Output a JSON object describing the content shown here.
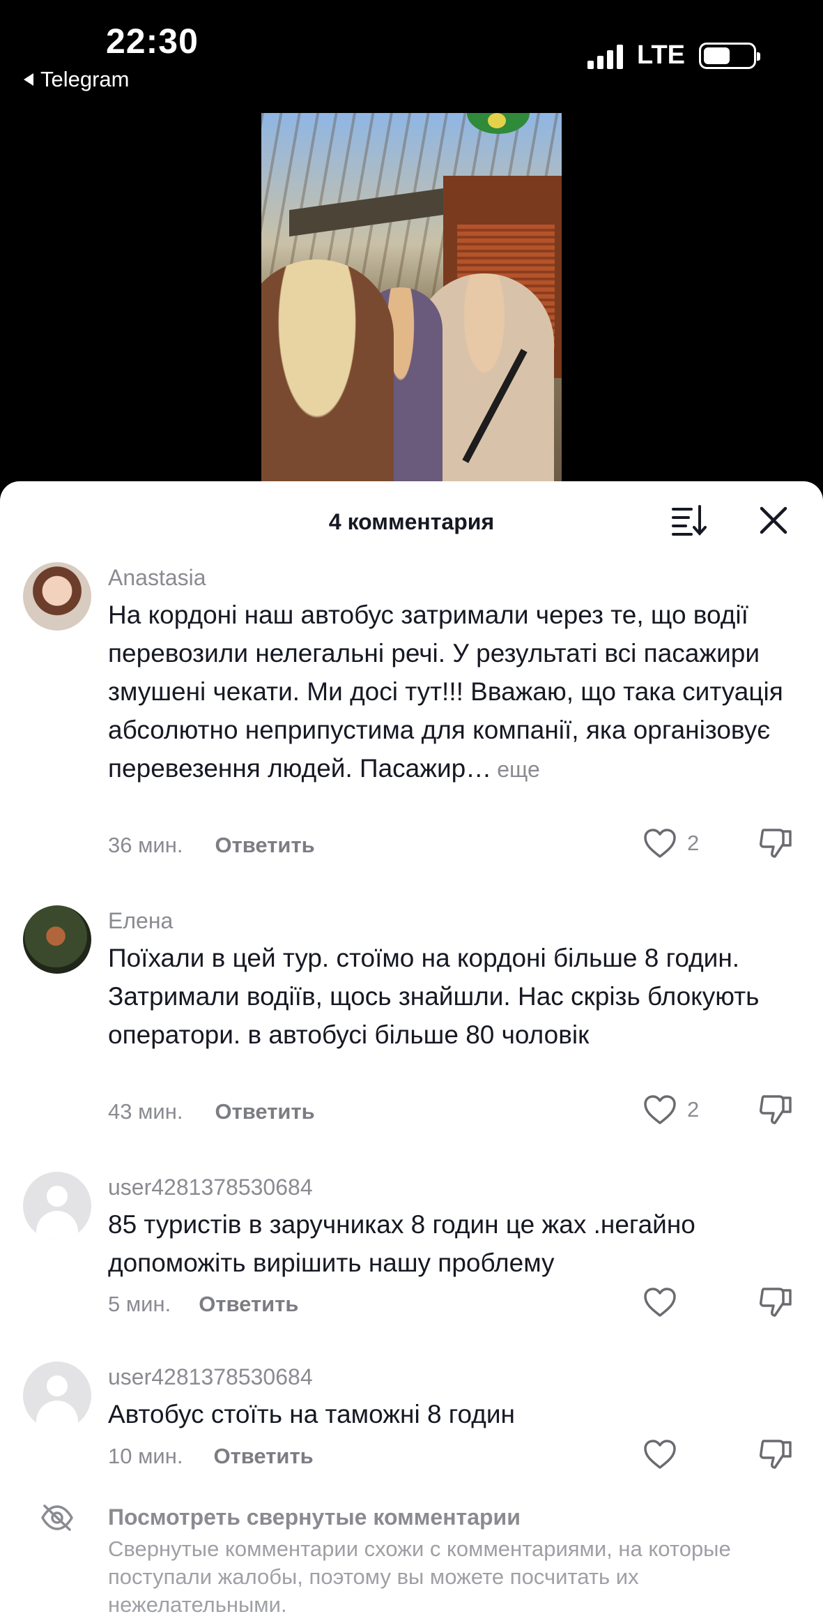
{
  "status_bar": {
    "time": "22:30",
    "back_app": "Telegram",
    "network": "LTE",
    "battery_level": 0.55
  },
  "header": {
    "title": "4 комментария",
    "sort_icon": "sort-icon",
    "close_icon": "close-icon"
  },
  "comments": [
    {
      "username": "Anastasia",
      "text": "На кордоні наш автобус затримали через те, що водії перевозили нелегальні речі. У результаті всі пасажири змушені чекати. Ми досі тут!!! Вважаю, що така ситуація абсолютно неприпустима для компанії, яка організовує перевезення людей. Пасажир…",
      "more": "еще",
      "time": "36 мин.",
      "reply": "Ответить",
      "likes": "2"
    },
    {
      "username": "Елена",
      "text": "Поїхали в цей тур. стоїмо на кордоні більше 8 годин. Затримали водіїв, щось знайшли. Нас скрізь блокують оператори. в автобусі більше 80 чоловік",
      "time": "43 мин.",
      "reply": "Ответить",
      "likes": "2"
    },
    {
      "username": "user4281378530684",
      "text": "85 туристів в заручниках 8 годин це жах .негайно допоможіть вирішить нашу проблему",
      "time": "5 мин.",
      "reply": "Ответить",
      "likes": ""
    },
    {
      "username": "user4281378530684",
      "text": "Автобус стоїть на таможні 8 годин",
      "time": "10 мин.",
      "reply": "Ответить",
      "likes": ""
    }
  ],
  "hidden": {
    "title": "Посмотреть свернутые комментарии",
    "description": "Свернутые комментарии схожи с комментариями, на которые поступали жалобы, поэтому вы можете посчитать их нежелательными."
  }
}
